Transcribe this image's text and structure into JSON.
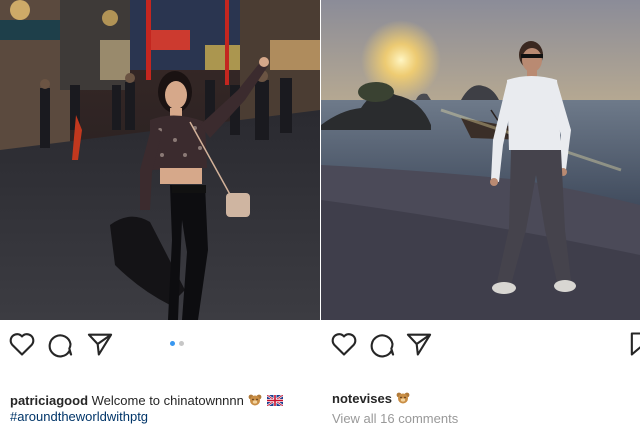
{
  "posts": [
    {
      "username": "patriciagood",
      "caption_text": "Welcome to chinatownnnn",
      "hashtag": "#aroundtheworldwithptg",
      "emoji": [
        "teddy-bear",
        "uk-flag"
      ],
      "carousel": {
        "count": 2,
        "active": 1
      },
      "actions": [
        "like-icon",
        "comment-icon",
        "share-icon"
      ]
    },
    {
      "username": "notevises",
      "emoji": [
        "teddy-bear"
      ],
      "view_comments": "View all 16 comments",
      "actions": [
        "like-icon",
        "comment-icon",
        "share-icon",
        "save-icon"
      ]
    }
  ],
  "colors": {
    "text": "#262626",
    "hashtag": "#003569",
    "muted": "#999999",
    "carousel_active": "#3897f0",
    "carousel_inactive": "#c7c7c7"
  }
}
